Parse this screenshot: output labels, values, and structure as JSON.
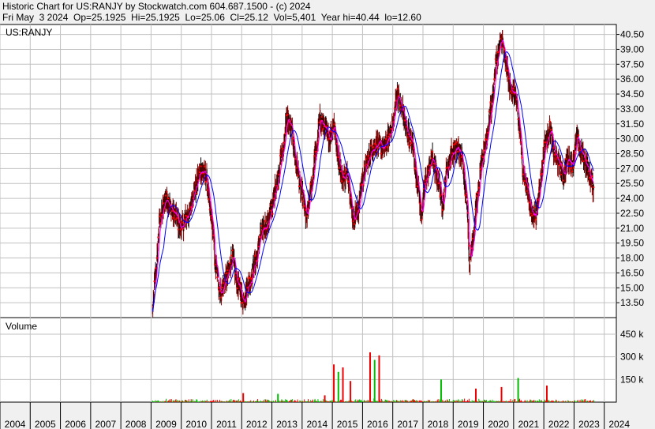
{
  "header": {
    "line1": "Historic Chart for US:RANJY by Stockwatch.com 604.687.1500 - (c) 2024",
    "line2": "Fri May  3 2024  Op=25.1925  Hi=25.1925  Lo=25.06  Cl=25.12  Vol=5,401  Year hi=40.44  lo=12.60"
  },
  "chart_data": {
    "type": "line",
    "symbol_label": "US:RANJY",
    "volume_label": "Volume",
    "x_ticks": [
      "2004",
      "2005",
      "2006",
      "2007",
      "2008",
      "2009",
      "2010",
      "2011",
      "2012",
      "2013",
      "2014",
      "2015",
      "2016",
      "2017",
      "2018",
      "2019",
      "2020",
      "2021",
      "2022",
      "2023",
      "2024"
    ],
    "xlim": [
      2004.0,
      2024.4
    ],
    "price_ticks": [
      "40.50",
      "39.00",
      "37.50",
      "36.00",
      "34.50",
      "33.00",
      "31.50",
      "30.00",
      "28.50",
      "27.00",
      "25.50",
      "24.00",
      "22.50",
      "21.00",
      "19.50",
      "18.00",
      "16.50",
      "15.00",
      "13.50"
    ],
    "ylim": [
      12.0,
      41.5
    ],
    "volume_ticks": [
      "450 k",
      "300 k",
      "150 k"
    ],
    "volume_ylim": [
      0,
      560000
    ],
    "price_anchors": [
      [
        2009.05,
        12.6
      ],
      [
        2009.15,
        16.5
      ],
      [
        2009.3,
        22.0
      ],
      [
        2009.5,
        24.0
      ],
      [
        2009.75,
        22.5
      ],
      [
        2010.0,
        21.0
      ],
      [
        2010.25,
        22.5
      ],
      [
        2010.45,
        25.0
      ],
      [
        2010.65,
        26.8
      ],
      [
        2010.8,
        26.5
      ],
      [
        2011.0,
        22.0
      ],
      [
        2011.15,
        17.0
      ],
      [
        2011.3,
        14.5
      ],
      [
        2011.5,
        16.0
      ],
      [
        2011.7,
        18.0
      ],
      [
        2011.85,
        15.5
      ],
      [
        2012.05,
        13.8
      ],
      [
        2012.25,
        15.5
      ],
      [
        2012.45,
        17.5
      ],
      [
        2012.65,
        20.5
      ],
      [
        2012.85,
        21.5
      ],
      [
        2013.0,
        23.0
      ],
      [
        2013.15,
        25.5
      ],
      [
        2013.35,
        28.5
      ],
      [
        2013.5,
        32.0
      ],
      [
        2013.65,
        31.0
      ],
      [
        2013.8,
        27.5
      ],
      [
        2014.0,
        24.5
      ],
      [
        2014.15,
        22.0
      ],
      [
        2014.3,
        25.0
      ],
      [
        2014.45,
        28.5
      ],
      [
        2014.6,
        32.0
      ],
      [
        2014.75,
        31.0
      ],
      [
        2014.9,
        30.0
      ],
      [
        2015.05,
        31.5
      ],
      [
        2015.2,
        28.0
      ],
      [
        2015.35,
        26.0
      ],
      [
        2015.5,
        26.5
      ],
      [
        2015.7,
        22.0
      ],
      [
        2015.85,
        22.8
      ],
      [
        2016.0,
        26.0
      ],
      [
        2016.15,
        27.5
      ],
      [
        2016.3,
        29.0
      ],
      [
        2016.5,
        29.5
      ],
      [
        2016.7,
        29.0
      ],
      [
        2016.85,
        30.0
      ],
      [
        2017.0,
        31.5
      ],
      [
        2017.15,
        34.5
      ],
      [
        2017.3,
        33.0
      ],
      [
        2017.5,
        30.5
      ],
      [
        2017.65,
        29.5
      ],
      [
        2017.8,
        26.0
      ],
      [
        2017.95,
        22.5
      ],
      [
        2018.1,
        26.0
      ],
      [
        2018.3,
        28.0
      ],
      [
        2018.5,
        26.0
      ],
      [
        2018.65,
        23.5
      ],
      [
        2018.8,
        27.0
      ],
      [
        2018.95,
        28.5
      ],
      [
        2019.15,
        29.0
      ],
      [
        2019.3,
        28.0
      ],
      [
        2019.45,
        24.0
      ],
      [
        2019.55,
        17.5
      ],
      [
        2019.65,
        20.0
      ],
      [
        2019.8,
        24.0
      ],
      [
        2019.95,
        27.5
      ],
      [
        2020.1,
        30.0
      ],
      [
        2020.25,
        33.0
      ],
      [
        2020.45,
        38.0
      ],
      [
        2020.6,
        40.0
      ],
      [
        2020.75,
        37.5
      ],
      [
        2020.9,
        35.0
      ],
      [
        2021.05,
        34.5
      ],
      [
        2021.2,
        31.0
      ],
      [
        2021.3,
        27.0
      ],
      [
        2021.45,
        25.0
      ],
      [
        2021.6,
        22.5
      ],
      [
        2021.75,
        22.5
      ],
      [
        2021.9,
        26.0
      ],
      [
        2022.05,
        29.5
      ],
      [
        2022.2,
        31.0
      ],
      [
        2022.35,
        28.5
      ],
      [
        2022.5,
        27.5
      ],
      [
        2022.65,
        26.5
      ],
      [
        2022.8,
        28.0
      ],
      [
        2022.95,
        27.5
      ],
      [
        2023.1,
        30.0
      ],
      [
        2023.25,
        28.5
      ],
      [
        2023.4,
        27.5
      ],
      [
        2023.55,
        26.0
      ],
      [
        2023.65,
        25.12
      ]
    ],
    "volume_spikes": [
      [
        2012.05,
        60000
      ],
      [
        2013.2,
        55000
      ],
      [
        2014.75,
        45000
      ],
      [
        2015.05,
        250000
      ],
      [
        2015.2,
        200000
      ],
      [
        2015.35,
        230000
      ],
      [
        2016.25,
        330000
      ],
      [
        2016.4,
        280000
      ],
      [
        2016.55,
        310000
      ],
      [
        2015.6,
        140000
      ],
      [
        2018.6,
        150000
      ],
      [
        2019.75,
        90000
      ],
      [
        2020.6,
        100000
      ],
      [
        2021.15,
        160000
      ],
      [
        2022.1,
        110000
      ]
    ],
    "series": [
      {
        "color": "#800000"
      },
      {
        "color": "#ff00ff"
      },
      {
        "color": "#0000ff"
      },
      {
        "color": "#ff0000"
      }
    ],
    "volume_colors": {
      "up": "#00bb00",
      "down": "#ee0000"
    },
    "grid": true,
    "grid_color": "#c0c0c0"
  }
}
